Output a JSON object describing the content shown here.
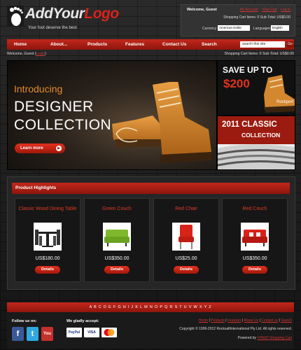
{
  "header": {
    "logo_part1": "AddYour",
    "logo_part2": "Logo",
    "tagline": "Your foot deserve the best",
    "welcome": "Welcome, Guest",
    "links": [
      "My Account",
      "View Cart",
      "Log In"
    ],
    "cart_summary": "Shopping Cart Items: 0   Sub-Total: US$0.00",
    "currency_label": "Currency",
    "currency_value": "American Dollar",
    "languages_label": "Languages",
    "language_value": "English"
  },
  "nav": {
    "items": [
      "Home",
      "About...",
      "Products",
      "Features",
      "Contact Us",
      "Search"
    ],
    "search_placeholder": "search this site",
    "go_label": "Go"
  },
  "subbar": {
    "welcome": "Welcome, Guest (",
    "login": "Login",
    "close": ")",
    "cart": "Shopping Cart Items: 0   Sub-Total: US$0.00"
  },
  "hero": {
    "intro": "Introducing",
    "line1": "DESIGNER",
    "line2": "COLLECTION",
    "button": "Learn more"
  },
  "side_banner_1": {
    "line1": "SAVE UP TO",
    "line2": "$200",
    "brand": "Rockport"
  },
  "side_banner_2": {
    "line1": "2011 CLASSIC",
    "line2": "COLLECTION"
  },
  "products": {
    "title": "Product Highlights",
    "items": [
      {
        "name": "Classic Wood Dining Table",
        "price": "US$180.00",
        "button": "Details"
      },
      {
        "name": "Green Couch",
        "price": "US$350.00",
        "button": "Details"
      },
      {
        "name": "Red Chair",
        "price": "US$25.00",
        "button": "Details"
      },
      {
        "name": "Red Couch",
        "price": "US$350.00",
        "button": "Details"
      }
    ]
  },
  "footer": {
    "alphabet": "A B C D E F G H I J K L M N O P Q R S T U V W X Y Z",
    "follow_label": "Follow us on:",
    "accept_label": "We gladly accept:",
    "social": [
      "f",
      "t",
      "You"
    ],
    "payments": [
      "PayPal",
      "VISA",
      "MasterCard"
    ],
    "links": [
      "Home",
      "Products",
      "Features",
      "About Us",
      "Contact us",
      "Search"
    ],
    "copyright": "Copyright © 1999-2012 RocksaltInternational Pty Ltd. All rights reserved.",
    "powered_prefix": "Powered by ",
    "powered_link": "VPASP Shopping Cart"
  },
  "colors": {
    "accent": "#c2281c",
    "accent_dark": "#8f150c",
    "price_name": "#e23a25"
  }
}
